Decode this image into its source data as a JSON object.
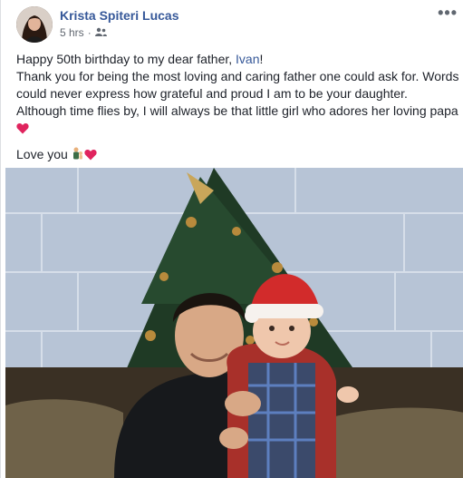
{
  "post": {
    "author_name": "Krista Spiteri Lucas",
    "timestamp": "5 hrs",
    "audience_icon": "friends-icon",
    "more_icon": "more-options-icon",
    "message": {
      "line1_prefix": "Happy 50th birthday to my dear father, ",
      "line1_link": "Ivan",
      "line1_suffix": "!",
      "line2": "Thank you for being the most loving and caring father one could ask for. Words could never express how grateful and proud I am to be your daughter. Although time flies by, I will always be that little girl who adores her loving papa",
      "line3": "Love you"
    },
    "emoji": {
      "heart": "heart-emoji",
      "father_child": "man-and-baby-emoji"
    },
    "colors": {
      "link": "#365899",
      "text": "#1d2129",
      "meta": "#616770",
      "heart": "#e0245e"
    }
  }
}
